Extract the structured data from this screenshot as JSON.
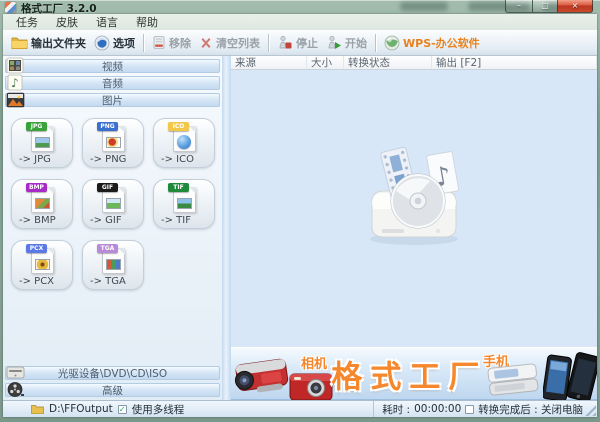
{
  "window": {
    "title": "格式工厂 3.2.0",
    "min_glyph": "–",
    "max_glyph": "□",
    "close_glyph": "×"
  },
  "menu": {
    "items": [
      "任务",
      "皮肤",
      "语言",
      "帮助"
    ]
  },
  "toolbar": {
    "output_folder": "输出文件夹",
    "options": "选项",
    "remove": "移除",
    "clear_list": "清空列表",
    "stop": "停止",
    "start": "开始",
    "wps": "WPS-办公软件",
    "wps_color": "#e8821e"
  },
  "sidebar": {
    "sections": [
      {
        "label": "视频"
      },
      {
        "label": "音频"
      },
      {
        "label": "图片"
      }
    ],
    "formats": [
      {
        "label": "-> JPG",
        "badge": "JPG",
        "badge_color": "#3aa23a"
      },
      {
        "label": "-> PNG",
        "badge": "PNG",
        "badge_color": "#3a6fd0"
      },
      {
        "label": "-> ICO",
        "badge": "ICO",
        "badge_color": "#f2c84b"
      },
      {
        "label": "-> BMP",
        "badge": "BMP",
        "badge_color": "#a82bc8"
      },
      {
        "label": "-> GIF",
        "badge": "GIF",
        "badge_color": "#1b1b1b"
      },
      {
        "label": "-> TIF",
        "badge": "TIF",
        "badge_color": "#1f8a3a"
      },
      {
        "label": "-> PCX",
        "badge": "PCX",
        "badge_color": "#5a78e8"
      },
      {
        "label": "-> TGA",
        "badge": "TGA",
        "badge_color": "#b98ad8"
      }
    ],
    "bottom_sections": [
      {
        "label": "光驱设备\\DVD\\CD\\ISO"
      },
      {
        "label": "高级"
      }
    ]
  },
  "table": {
    "columns": [
      "来源",
      "大小",
      "转换状态",
      "输出 [F2]"
    ]
  },
  "banner": {
    "camera_label": "相机",
    "phone_label": "手机",
    "brand": "格式工厂",
    "brand_color": "#f5872c"
  },
  "statusbar": {
    "output_path": "D:\\FFOutput",
    "multithread_label": "使用多线程",
    "multithread_check": "✓",
    "elapsed_label": "耗时 :",
    "elapsed_value": "00:00:00",
    "shutdown_label": "转换完成后 : 关闭电脑"
  }
}
